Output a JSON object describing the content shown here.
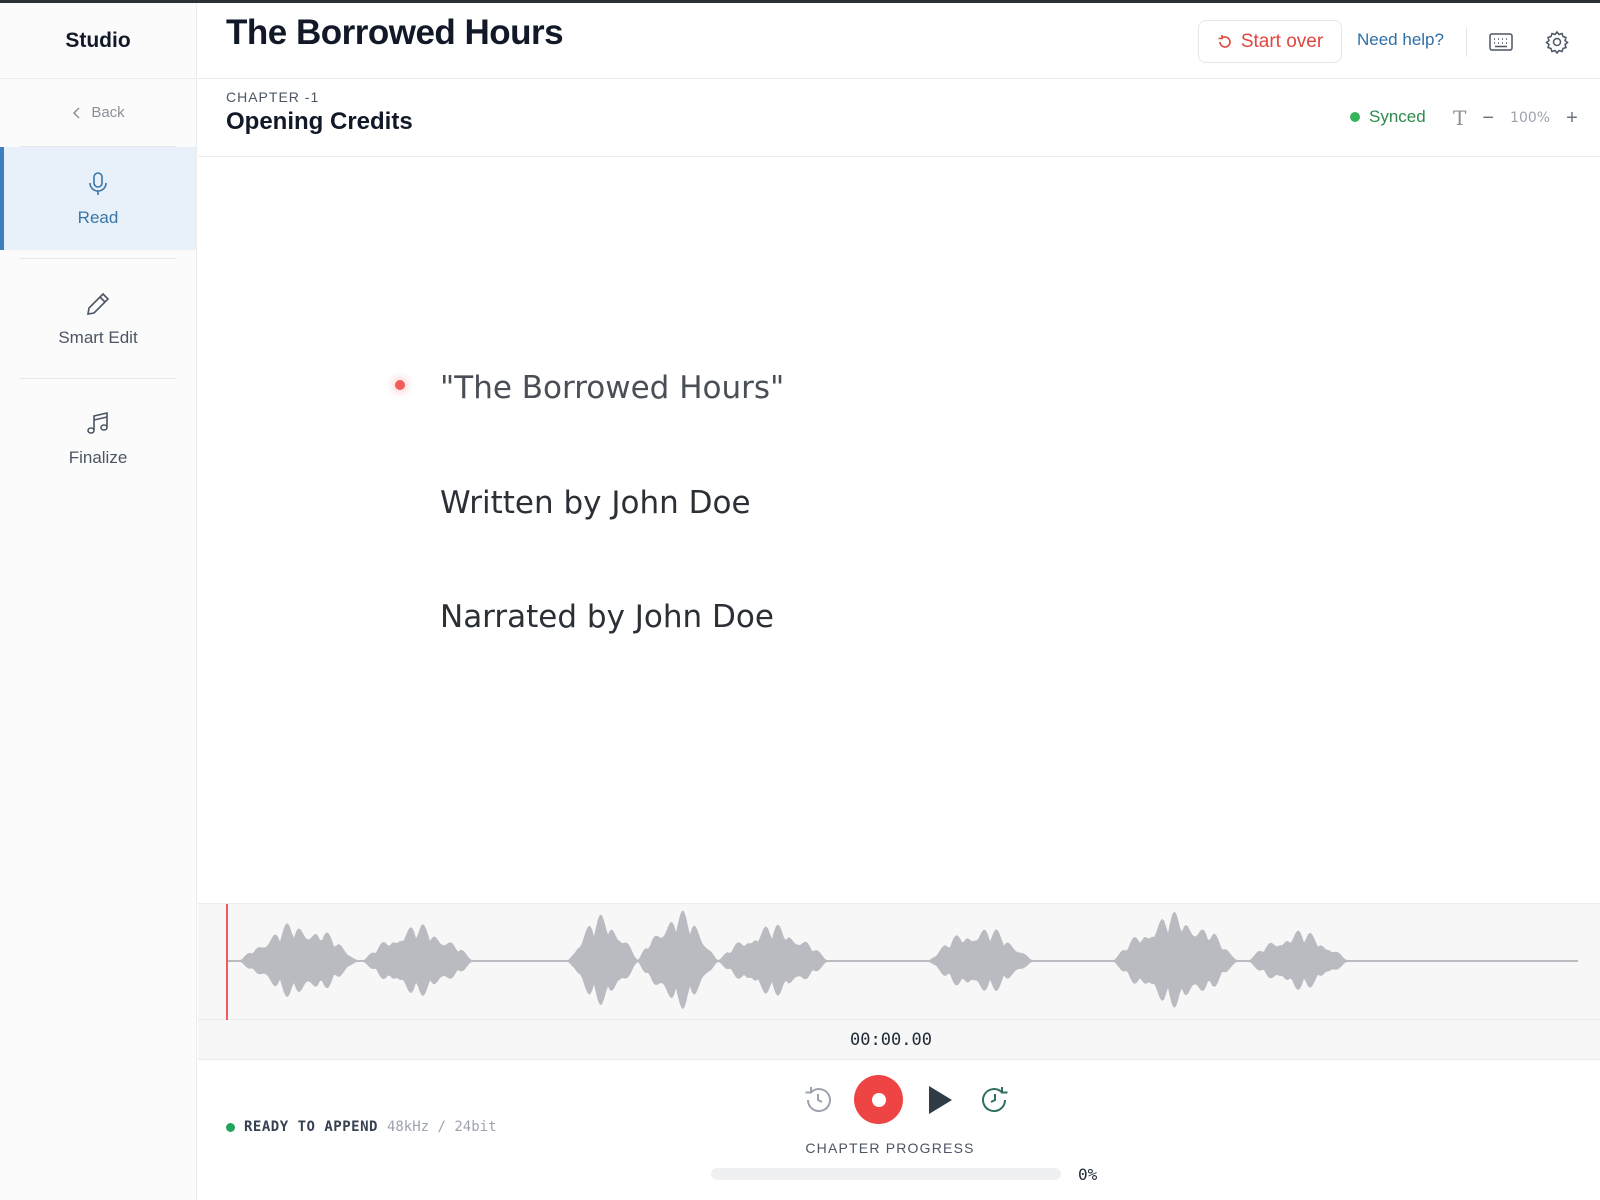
{
  "sidebar": {
    "brand": "Studio",
    "back_label": "Back",
    "items": [
      {
        "label": "Read",
        "icon": "microphone-icon",
        "active": true
      },
      {
        "label": "Smart Edit",
        "icon": "pencil-icon",
        "active": false
      },
      {
        "label": "Finalize",
        "icon": "music-note-icon",
        "active": false
      }
    ]
  },
  "header": {
    "title": "The Borrowed Hours",
    "start_over_label": "Start over",
    "help_label": "Need help?",
    "icons": [
      "keyboard-icon",
      "gear-icon"
    ]
  },
  "chapter": {
    "label": "CHAPTER -1",
    "title": "Opening Credits",
    "sync_status": "Synced",
    "zoom": "100%"
  },
  "manuscript": {
    "lines": [
      "\"The Borrowed Hours\"",
      "Written by John Doe",
      "Narrated by John Doe"
    ],
    "current_line_index": 0
  },
  "player": {
    "timecode": "00:00.00",
    "status_label": "READY TO APPEND",
    "audio_spec": "48kHz / 24bit",
    "progress_label": "CHAPTER PROGRESS",
    "progress_text": "0%",
    "progress_value": 0
  },
  "colors": {
    "accent": "#3d7fbd",
    "record": "#ef4444",
    "synced": "#34b55a",
    "danger_text": "#e0463f",
    "link": "#2f6fa6"
  }
}
